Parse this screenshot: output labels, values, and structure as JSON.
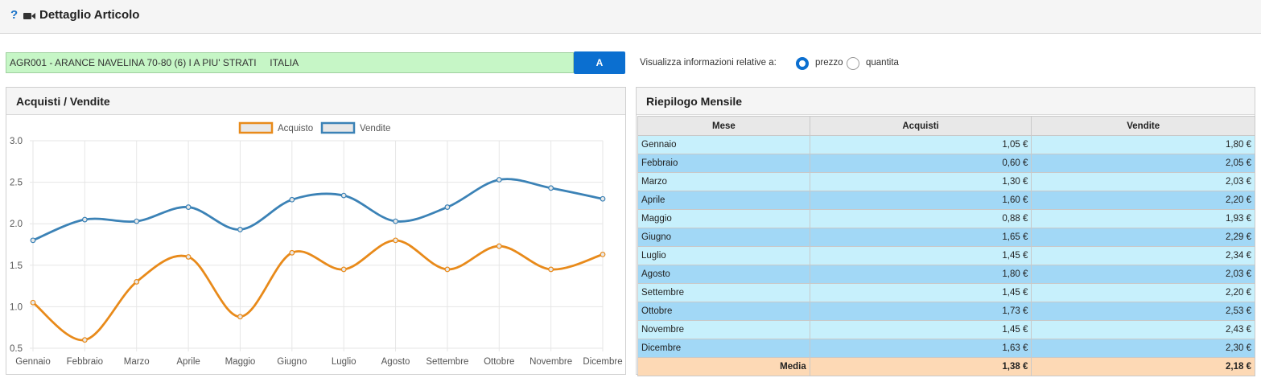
{
  "header": {
    "title": "Dettaglio Articolo",
    "help_glyph": "?"
  },
  "article": {
    "value": "AGR001 - ARANCE NAVELINA 70-80 (6) I A PIU' STRATI     ITALIA",
    "button_label": "A"
  },
  "view_options": {
    "label": "Visualizza informazioni relative a:",
    "option_prezzo": "prezzo",
    "option_quantita": "quantita",
    "selected": "prezzo"
  },
  "chart_panel": {
    "title": "Acquisti / Vendite"
  },
  "chart_data": {
    "type": "line",
    "categories": [
      "Gennaio",
      "Febbraio",
      "Marzo",
      "Aprile",
      "Maggio",
      "Giugno",
      "Luglio",
      "Agosto",
      "Settembre",
      "Ottobre",
      "Novembre",
      "Dicembre"
    ],
    "series": [
      {
        "name": "Acquisto",
        "color": "#e88a1a",
        "values": [
          1.05,
          0.6,
          1.3,
          1.6,
          0.88,
          1.65,
          1.45,
          1.8,
          1.45,
          1.73,
          1.45,
          1.63
        ]
      },
      {
        "name": "Vendite",
        "color": "#3b82b6",
        "values": [
          1.8,
          2.05,
          2.03,
          2.2,
          1.93,
          2.29,
          2.34,
          2.03,
          2.2,
          2.53,
          2.43,
          2.3
        ]
      }
    ],
    "ylim": [
      0.5,
      3.0
    ],
    "yticks": [
      "0.5",
      "1.0",
      "1.5",
      "2.0",
      "2.5",
      "3.0"
    ],
    "legend": "top-center",
    "grid": true
  },
  "table_panel": {
    "title": "Riepilogo Mensile",
    "headers": [
      "Mese",
      "Acquisti",
      "Vendite"
    ],
    "rows": [
      {
        "mese": "Gennaio",
        "acquisti": "1,05 €",
        "vendite": "1,80 €"
      },
      {
        "mese": "Febbraio",
        "acquisti": "0,60 €",
        "vendite": "2,05 €"
      },
      {
        "mese": "Marzo",
        "acquisti": "1,30 €",
        "vendite": "2,03 €"
      },
      {
        "mese": "Aprile",
        "acquisti": "1,60 €",
        "vendite": "2,20 €"
      },
      {
        "mese": "Maggio",
        "acquisti": "0,88 €",
        "vendite": "1,93 €"
      },
      {
        "mese": "Giugno",
        "acquisti": "1,65 €",
        "vendite": "2,29 €"
      },
      {
        "mese": "Luglio",
        "acquisti": "1,45 €",
        "vendite": "2,34 €"
      },
      {
        "mese": "Agosto",
        "acquisti": "1,80 €",
        "vendite": "2,03 €"
      },
      {
        "mese": "Settembre",
        "acquisti": "1,45 €",
        "vendite": "2,20 €"
      },
      {
        "mese": "Ottobre",
        "acquisti": "1,73 €",
        "vendite": "2,53 €"
      },
      {
        "mese": "Novembre",
        "acquisti": "1,45 €",
        "vendite": "2,43 €"
      },
      {
        "mese": "Dicembre",
        "acquisti": "1,63 €",
        "vendite": "2,30 €"
      }
    ],
    "footer": {
      "label": "Media",
      "acquisti": "1,38 €",
      "vendite": "2,18 €"
    }
  }
}
